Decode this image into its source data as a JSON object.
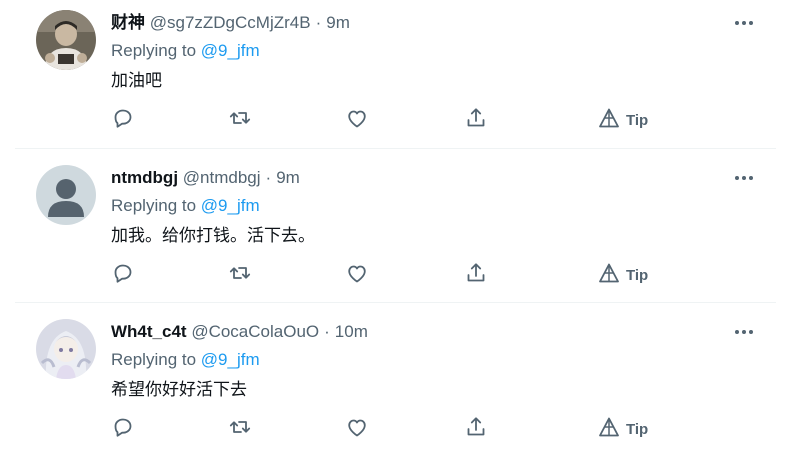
{
  "replying_prefix": "Replying to",
  "tip_label": "Tip",
  "tweets": [
    {
      "display_name": "财神",
      "handle": "@sg7zZDgCcMjZr4B",
      "time": "9m",
      "reply_to": "@9_jfm",
      "text": "加油吧",
      "avatar": "photo-avatar"
    },
    {
      "display_name": "ntmdbgj",
      "handle": "@ntmdbgj",
      "time": "9m",
      "reply_to": "@9_jfm",
      "text": "加我。给你打钱。活下去。",
      "avatar": "default-avatar"
    },
    {
      "display_name": "Wh4t_c4t",
      "handle": "@CocaColaOuO",
      "time": "10m",
      "reply_to": "@9_jfm",
      "text": "希望你好好活下去",
      "avatar": "anime-avatar"
    }
  ],
  "colors": {
    "text": "#0f1419",
    "secondary": "#536471",
    "link": "#1d9bf0",
    "divider": "#eff3f4"
  }
}
